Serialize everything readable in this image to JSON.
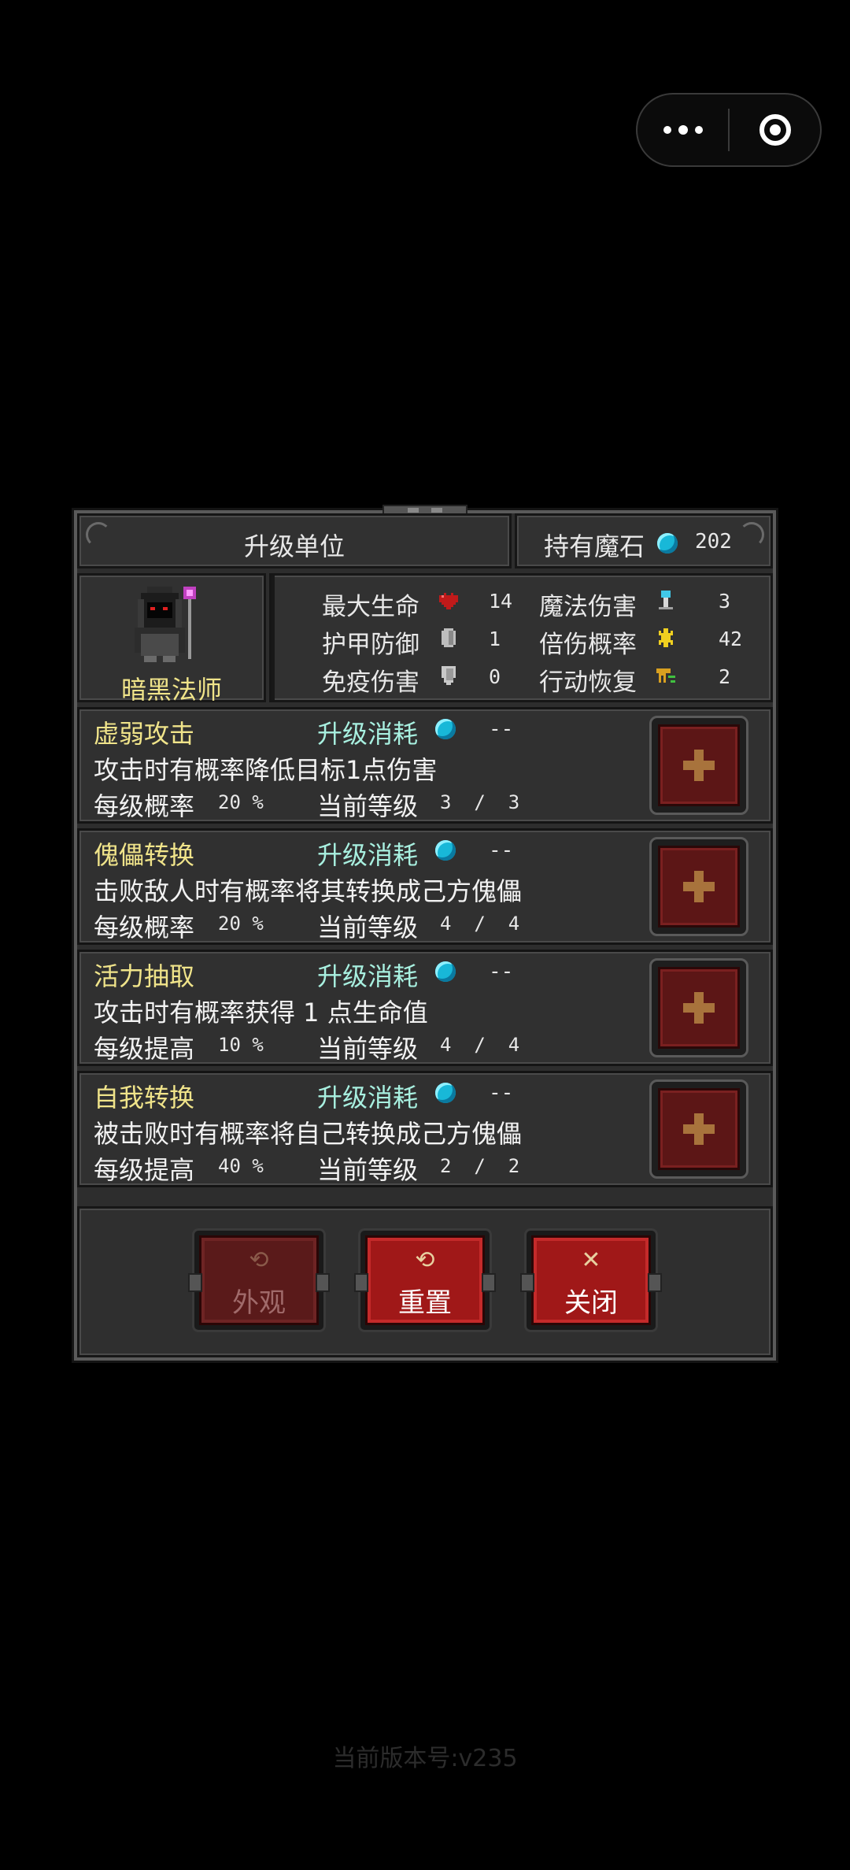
{
  "capsule": {
    "more_icon": "more-dots-icon",
    "close_icon": "target-icon"
  },
  "header": {
    "title": "升级单位",
    "stone_label": "持有魔石",
    "stone_count": "202"
  },
  "unit": {
    "name": "暗黑法师",
    "stats": [
      {
        "label": "最大生命",
        "value": "14",
        "icon": "heart-icon"
      },
      {
        "label": "魔法伤害",
        "value": "3",
        "icon": "staff-icon"
      },
      {
        "label": "护甲防御",
        "value": "1",
        "icon": "armor-icon"
      },
      {
        "label": "倍伤概率",
        "value": "42",
        "icon": "crit-star-icon"
      },
      {
        "label": "免疫伤害",
        "value": "0",
        "icon": "shield-icon"
      },
      {
        "label": "行动恢复",
        "value": "2",
        "icon": "boot-icon"
      }
    ]
  },
  "skills": [
    {
      "name": "虚弱攻击",
      "cost_label": "升级消耗",
      "cost": "--",
      "desc": "攻击时有概率降低目标1点伤害",
      "rate_label": "每级概率",
      "rate": "20 %",
      "level_label": "当前等级",
      "level": "3  /  3"
    },
    {
      "name": "傀儡转换",
      "cost_label": "升级消耗",
      "cost": "--",
      "desc": "击败敌人时有概率将其转换成己方傀儡",
      "rate_label": "每级概率",
      "rate": "20 %",
      "level_label": "当前等级",
      "level": "4  /  4"
    },
    {
      "name": "活力抽取",
      "cost_label": "升级消耗",
      "cost": "--",
      "desc": "攻击时有概率获得 1 点生命值",
      "rate_label": "每级提高",
      "rate": "10 %",
      "level_label": "当前等级",
      "level": "4  /  4"
    },
    {
      "name": "自我转换",
      "cost_label": "升级消耗",
      "cost": "--",
      "desc": "被击败时有概率将自己转换成己方傀儡",
      "rate_label": "每级提高",
      "rate": "40 %",
      "level_label": "当前等级",
      "level": "2  /  2"
    }
  ],
  "actions": {
    "appearance": "外观",
    "reset": "重置",
    "close": "关闭"
  },
  "version": "当前版本号:v235",
  "colors": {
    "accent_red": "#a01818",
    "gem_cyan": "#18b8d8",
    "name_yellow": "#f0e48a",
    "cost_label_cyan": "#a8f0e0"
  }
}
